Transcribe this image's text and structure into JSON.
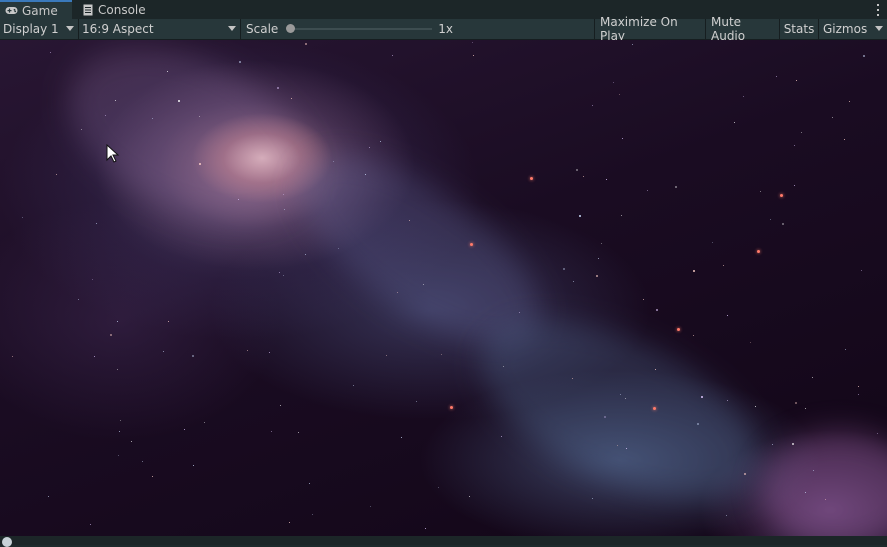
{
  "tabs": [
    {
      "label": "Game",
      "icon": "gamepad-icon",
      "active": true
    },
    {
      "label": "Console",
      "icon": "console-icon",
      "active": false
    }
  ],
  "toolbar": {
    "display_label": "Display 1",
    "aspect_label": "16:9 Aspect",
    "scale_label": "Scale",
    "scale_value": "1x",
    "scale_level": 0,
    "maximize_label": "Maximize On Play",
    "mute_label": "Mute Audio",
    "stats_label": "Stats",
    "gizmos_label": "Gizmos"
  },
  "viewport": {
    "content": "galaxy-space-scene"
  },
  "colors": {
    "tab_accent": "#3a79bb",
    "toolbar_bg": "#27373a",
    "tabbar_bg": "#1c2628"
  }
}
